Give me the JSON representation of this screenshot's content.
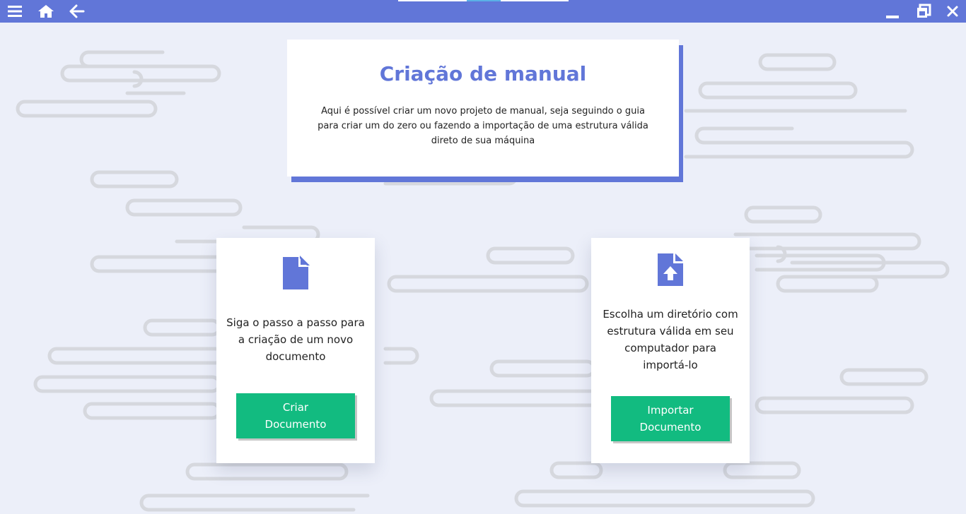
{
  "topbar": {
    "menu_icon": "menu-icon",
    "home_icon": "home-icon",
    "back_icon": "arrow-left-icon",
    "minimize_icon": "minimize-icon",
    "restore_icon": "restore-icon",
    "close_icon": "close-icon"
  },
  "hero": {
    "title": "Criação de manual",
    "description": "Aqui é possível criar um novo projeto de manual, seja seguindo o guia para criar um do zero ou fazendo a importação de uma estrutura válida direto de sua máquina"
  },
  "cards": [
    {
      "icon": "file-icon",
      "text": "Siga o passo a passo para a criação de um novo documento",
      "button_label": "Criar Documento"
    },
    {
      "icon": "file-upload-icon",
      "text": "Escolha um diretório com estrutura válida em seu computador para importá-lo",
      "button_label": "Importar Documento"
    }
  ],
  "colors": {
    "primary": "#6176d8",
    "button": "#12bb80",
    "background": "#eceff9"
  }
}
